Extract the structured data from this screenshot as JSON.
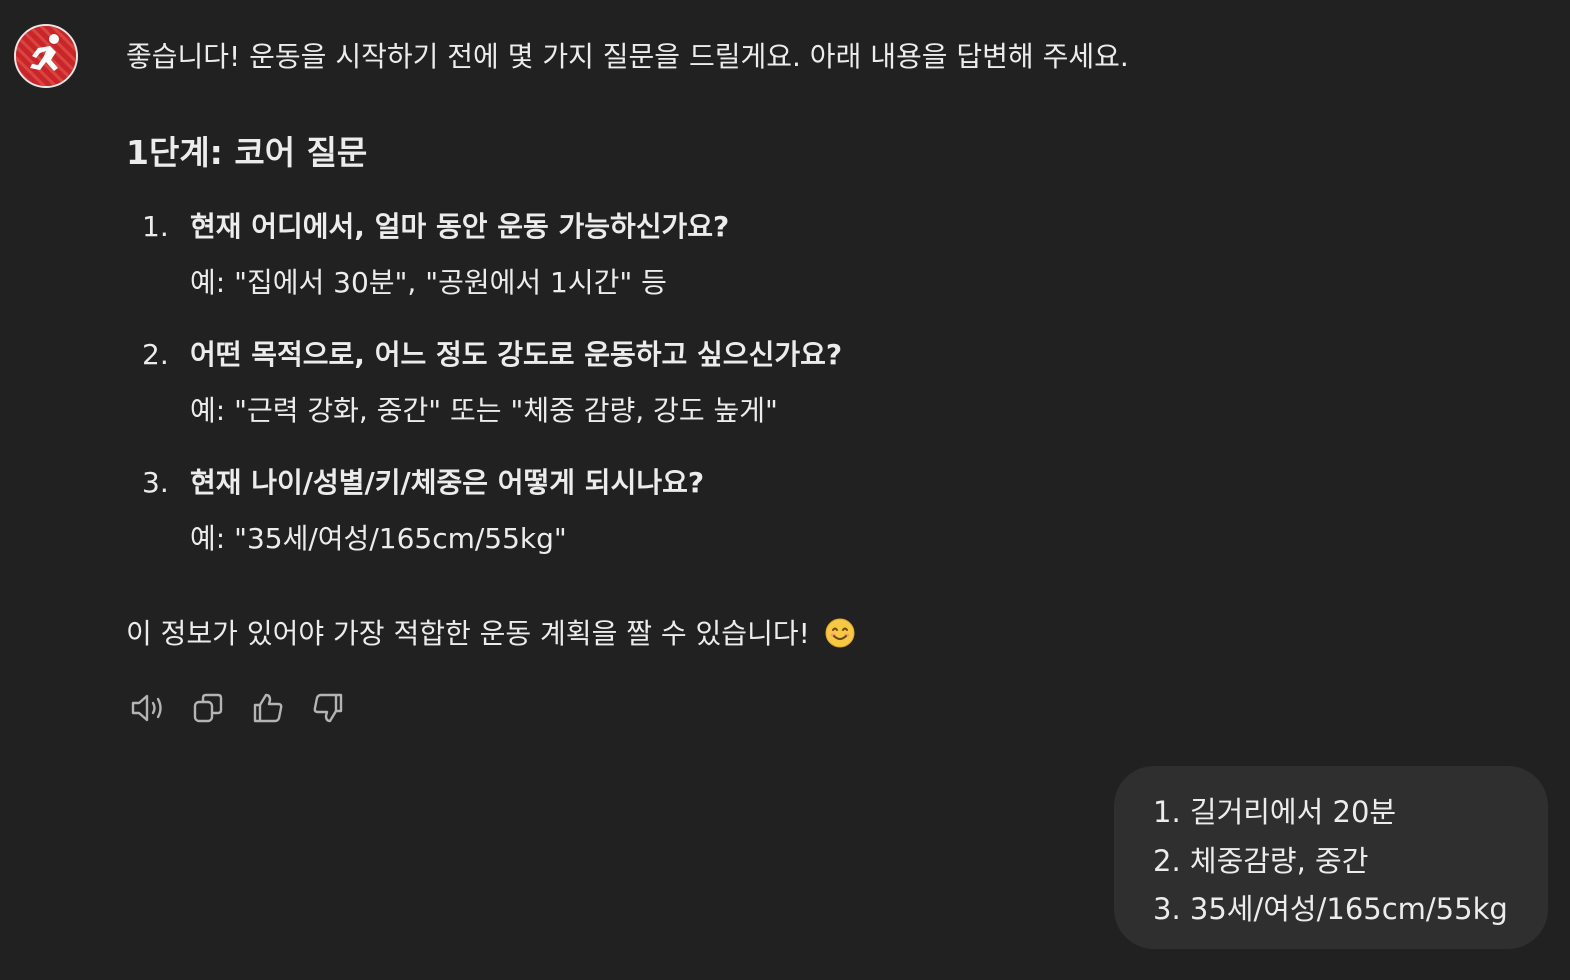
{
  "assistant": {
    "avatar_icon": "running-person-icon",
    "accent_color": "#c8262c",
    "intro": "좋습니다! 운동을 시작하기 전에 몇 가지 질문을 드릴게요. 아래 내용을 답변해 주세요.",
    "heading": "1단계: 코어 질문",
    "questions": [
      {
        "number": "1.",
        "text": "현재 어디에서, 얼마 동안 운동 가능하신가요?",
        "example": "예: \"집에서 30분\", \"공원에서 1시간\" 등"
      },
      {
        "number": "2.",
        "text": "어떤 목적으로, 어느 정도 강도로 운동하고 싶으신가요?",
        "example": "예: \"근력 강화, 중간\" 또는 \"체중 감량, 강도 높게\""
      },
      {
        "number": "3.",
        "text": "현재 나이/성별/키/체중은 어떻게 되시나요?",
        "example": "예: \"35세/여성/165cm/55kg\""
      }
    ],
    "closing": "이 정보가 있어야 가장 적합한 운동 계획을 짤 수 있습니다!",
    "closing_emoji": "smiling-face-icon"
  },
  "actions": [
    {
      "icon": "speaker-icon"
    },
    {
      "icon": "copy-icon"
    },
    {
      "icon": "thumbs-up-icon"
    },
    {
      "icon": "thumbs-down-icon"
    }
  ],
  "user_message": {
    "lines": [
      "1. 길거리에서 20분",
      "2. 체중감량, 중간",
      "3. 35세/여성/165cm/55kg"
    ]
  }
}
